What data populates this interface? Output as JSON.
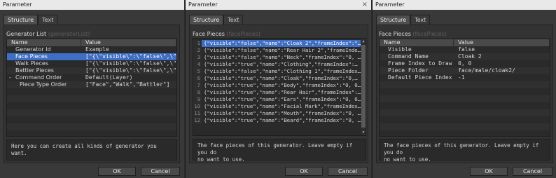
{
  "window_title": "Parameter",
  "tabs": [
    "Structure",
    "Text"
  ],
  "ok_label": "OK",
  "cancel_label": "Cancel",
  "close_glyph": "×",
  "w1": {
    "section_label": "Generator List",
    "section_sub": "(generatorList)",
    "columns": [
      "Name",
      "Value"
    ],
    "rows": [
      {
        "name": "Generator Id",
        "value": "Example"
      },
      {
        "name": "Face Pieces",
        "value": "[\"{\\\"visible\\\":\\\"false\\\",\\\"…"
      },
      {
        "name": "Walk Pieces",
        "value": "[\"{\\\"visible\\\":\\\"false\\\",\\\"…"
      },
      {
        "name": "Battler Pieces",
        "value": "[\"{\\\"visible\\\":\\\"false\\\",\\\"…"
      },
      {
        "name": "Command Order",
        "value": "Default(Layer)",
        "expander": "-"
      },
      {
        "name": "Piece Type Order",
        "value": "[\"Face\",\"Walk\",\"Battler\"]"
      }
    ],
    "description": "Here you can create all kinds of generator you want."
  },
  "w2": {
    "section_label": "Face Pieces",
    "section_sub": "(facePieces)",
    "lines": [
      "{\"visible\":\"false\",\"name\":\"Cloak 2\",\"frameIndex\":\"…",
      "{\"visible\":\"false\",\"name\":\"Rear Hair 2\",\"frameInde…",
      "{\"visible\":\"false\",\"name\":\"Neck\",\"frameIndex\":\"0, …",
      "{\"visible\":\"true\",\"name\":\"Clothing\",\"frameIndex\":…",
      "{\"visible\":\"false\",\"name\":\"Clothing 1\",\"frameIndex…",
      "{\"visible\":\"true\",\"name\":\"Cloak\",\"frameIndex\":\"0,…",
      "{\"visible\":\"true\",\"name\":\"Body\",\"frameIndex\":\"0, 0…",
      "{\"visible\":\"true\",\"name\":\"Rear Hair\",\"frameIndex\":…",
      "{\"visible\":\"true\",\"name\":\"Ears\",\"frameIndex\":\"0, 0…",
      "{\"visible\":\"true\",\"name\":\"Facial Mark\",\"frameIndex…",
      "{\"visible\":\"true\",\"name\":\"Mouth\",\"frameIndex\":\"0, …",
      "{\"visible\":\"true\",\"name\":\"Beard\",\"frameIndex\":\"0, …"
    ],
    "description_1": "The face pieces of this generator. Leave empty if you do",
    "description_2": "no want to use."
  },
  "w3": {
    "section_label": "Face Pieces",
    "section_sub": "(facePieces)",
    "columns": [
      "Name",
      "Value"
    ],
    "rows": [
      {
        "name": "Visible",
        "value": "false"
      },
      {
        "name": "Command Name",
        "value": "Cloak 2"
      },
      {
        "name": "Frame Index to Draw",
        "value": "0, 0"
      },
      {
        "name": "Piece Folder",
        "value": "face/male/cloak2/"
      },
      {
        "name": "Default Piece Index",
        "value": "-1"
      }
    ],
    "description_1": "The face pieces of this generator. Leave empty if you do",
    "description_2": "no want to use."
  }
}
